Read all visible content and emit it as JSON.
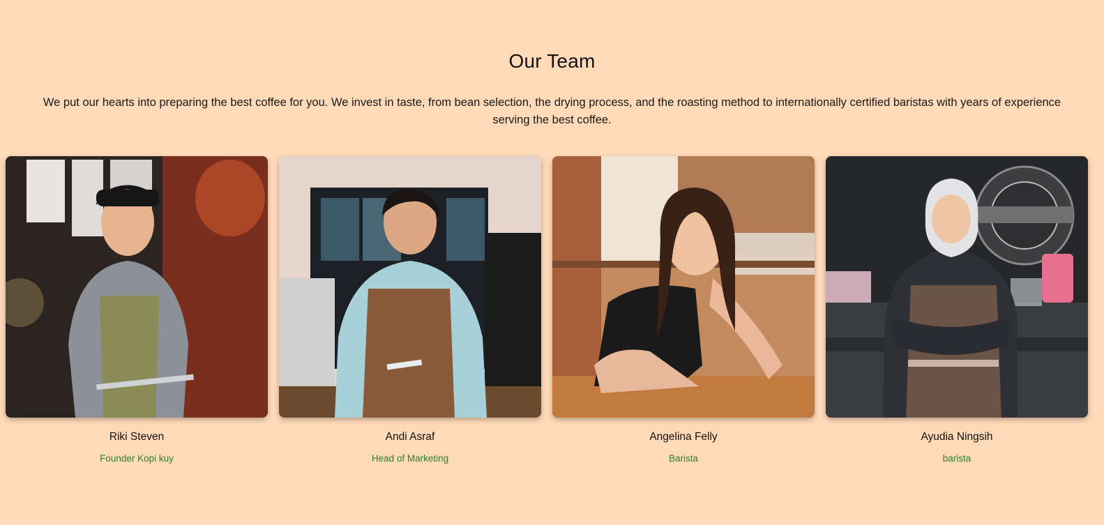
{
  "section": {
    "title": "Our Team",
    "description": "We put our hearts into preparing the best coffee for you. We invest in taste, from bean selection, the drying process, and the roasting method to internationally certified baristas with years of experience serving the best coffee."
  },
  "team": [
    {
      "name": "Riki Steven",
      "role": "Founder Kopi kuy"
    },
    {
      "name": "Andi Asraf",
      "role": "Head of Marketing"
    },
    {
      "name": "Angelina Felly",
      "role": "Barista"
    },
    {
      "name": "Ayudia Ningsih",
      "role": "barista"
    }
  ],
  "colors": {
    "background": "#ffdab9",
    "role_text": "#2e7d32"
  }
}
